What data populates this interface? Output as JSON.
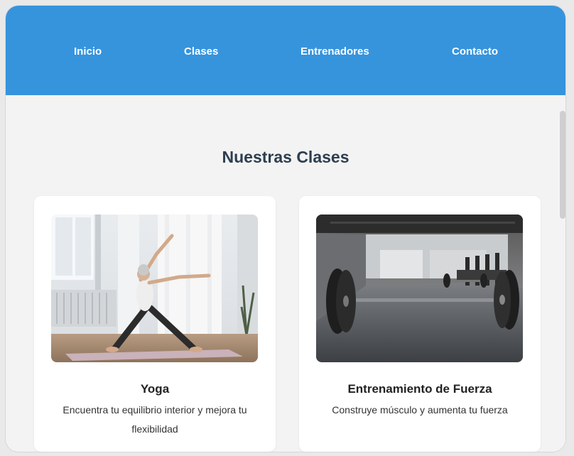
{
  "nav": {
    "items": [
      {
        "label": "Inicio"
      },
      {
        "label": "Clases"
      },
      {
        "label": "Entrenadores"
      },
      {
        "label": "Contacto"
      }
    ]
  },
  "section": {
    "title": "Nuestras Clases"
  },
  "cards": [
    {
      "title": "Yoga",
      "description": "Encuentra tu equilibrio interior y mejora tu flexibilidad"
    },
    {
      "title": "Entrenamiento de Fuerza",
      "description": "Construye músculo y aumenta tu fuerza"
    }
  ],
  "colors": {
    "nav_background": "#3694dd",
    "page_background": "#f3f3f3",
    "title_text": "#2d3e50"
  }
}
